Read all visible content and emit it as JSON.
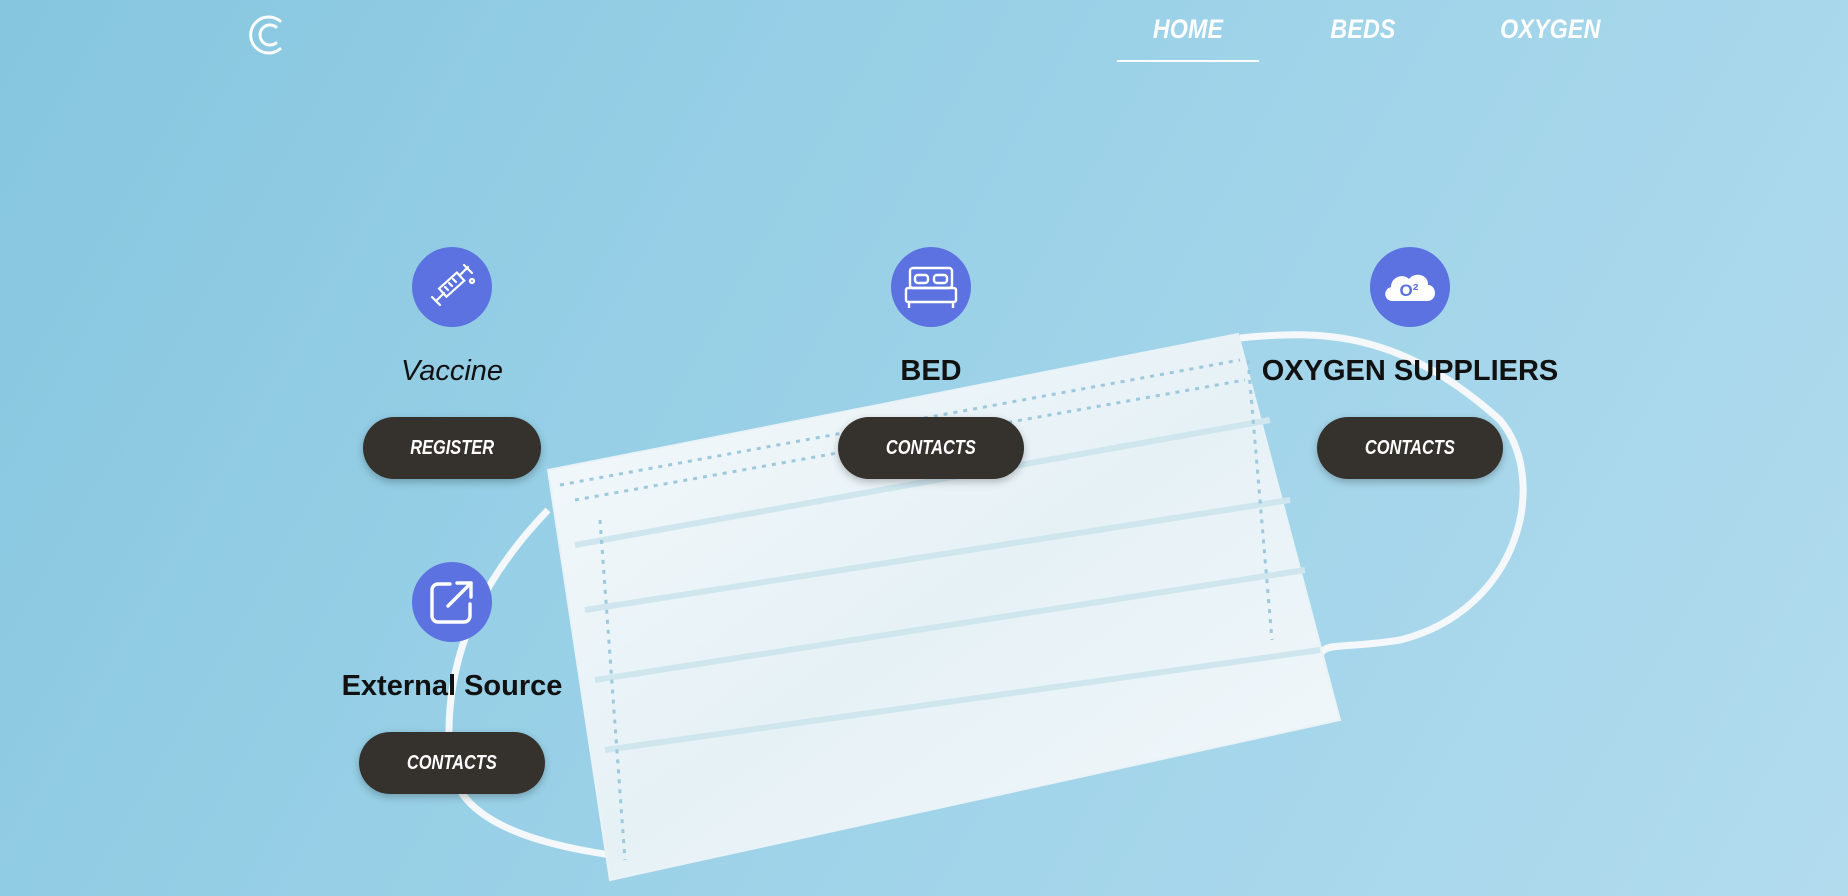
{
  "nav": {
    "items": [
      {
        "label": "HOME"
      },
      {
        "label": "BEDS"
      },
      {
        "label": "OXYGEN"
      }
    ]
  },
  "cards": [
    {
      "title": "Vaccine",
      "button": "REGISTER",
      "icon": "syringe-icon"
    },
    {
      "title": "BED",
      "button": "CONTACTS",
      "icon": "bed-icon"
    },
    {
      "title": "OXYGEN SUPPLIERS",
      "button": "CONTACTS",
      "icon": "oxygen-cloud-icon",
      "icon_text": "O²"
    },
    {
      "title": "External Source",
      "button": "CONTACTS",
      "icon": "external-link-icon"
    }
  ],
  "colors": {
    "accent": "#5b72e0",
    "button": "#35312c",
    "background": "#96cfe6"
  }
}
